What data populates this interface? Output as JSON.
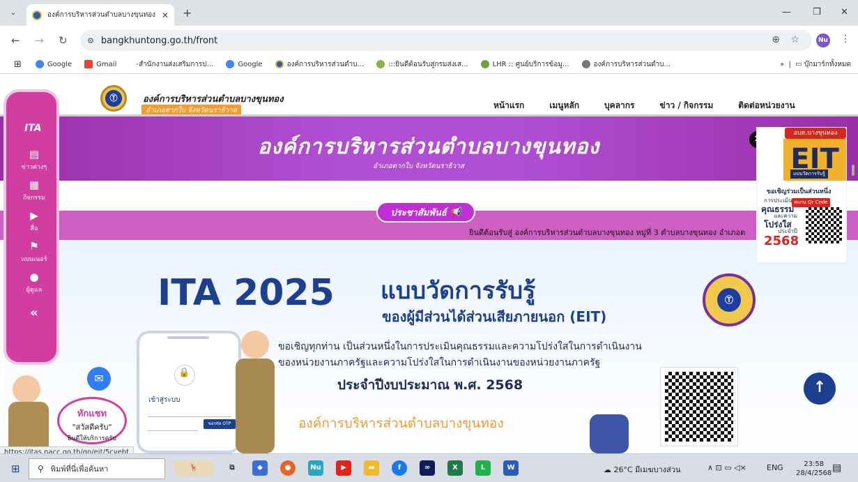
{
  "browser": {
    "tab_title": "องค์การบริหารส่วนตำบลบางขุนทอง",
    "url": "bangkhuntong.go.th/front",
    "profile": "Nu",
    "bookmarks": [
      "Google",
      "Gmail",
      "-สำนักงานส่งเสริมการป...",
      "Google",
      "องค์การบริหารส่วนตำบ...",
      ":::ยินดีต้อนรับสู่กรมส่งเส...",
      "LHR :: ศูนย์บริการข้อมู...",
      "องค์การบริหารส่วนตำบ..."
    ],
    "bookmarks_all": "บุ๊กมาร์กทั้งหมด",
    "status_url": "https://itas.nacc.go.th/go/eit/5cvebt"
  },
  "site": {
    "org_name": "องค์การบริหารส่วนตำบลบางขุนทอง",
    "org_sub": "อำเภอตากใบ จังหวัดนราธิวาส",
    "menu": [
      "หน้าแรก",
      "เมนูหลัก",
      "บุคลากร",
      "ข่าว / กิจกรรม",
      "ติดต่อหน่วยงาน"
    ],
    "banner_title": "องค์การบริหารส่วนตำบลบางขุนทอง",
    "banner_sub": "อำเภอตากใบ จังหวัดนราธิวาส",
    "pr_label": "ประชาสัมพันธ์",
    "marquee": "ยินดีต้อนรับสู่ องค์การบริหารส่วนตำบลบางขุนทอง หมู่ที่ 3 ตำบลบางขุนทอง อำเภอต"
  },
  "sidenav": {
    "logo": "ITA",
    "items": [
      {
        "icon": "news-icon",
        "glyph": "▤",
        "label": "ข่าวต่างๆ"
      },
      {
        "icon": "calendar-icon",
        "glyph": "▦",
        "label": "กิจกรรม"
      },
      {
        "icon": "play-icon",
        "glyph": "▶",
        "label": "สื่อ"
      },
      {
        "icon": "flag-icon",
        "glyph": "⚑",
        "label": "แบนเนอร์"
      },
      {
        "icon": "user-icon",
        "glyph": "●",
        "label": "ผู้ดูแล"
      }
    ],
    "collapse": "«"
  },
  "ita": {
    "year": "ITA 2025",
    "title1": "แบบวัดการรับรู้",
    "title2": "ของผู้มีส่วนได้ส่วนเสียภายนอก (EIT)",
    "p1": "ขอเชิญทุกท่าน เป็นส่วนหนึ่งในการประเมินคุณธรรมและความโปร่งใสในการดำเนินงาน",
    "p2": "ของหน่วยงานภาครัฐและความโปร่งใสในการดำเนินงานของหน่วยงานภาครัฐ",
    "budget": "ประจำปีงบประมาณ พ.ศ. 2568",
    "org": "องค์การบริหารส่วนตำบลบางขุนทอง",
    "phone_login": "เข้าสู่ระบบ",
    "phone_btn": "ขอรหัส OTP"
  },
  "chat": {
    "line1": "ทักแชท",
    "line2": "\"สวัสดีครับ\"",
    "line3": "ยินดีให้บริการครับ"
  },
  "ad": {
    "badge": "อบต.บางขุนทอง",
    "eit": "EIT",
    "eit_sub": "แบบวัดการรับรู้",
    "invite": "ขอเชิญร่วมเป็นส่วนหนึ่ง",
    "t1": "การประเมิน",
    "t2": "คุณธรรม",
    "t3": "และความ",
    "t4": "โปร่งใส",
    "t5": "ประจำปี",
    "year": "2568",
    "scan": "สแกน Qr Code",
    "close": "×"
  },
  "taskbar": {
    "search_placeholder": "พิมพ์ที่นี่เพื่อค้นหา",
    "weather": "26°C มีเมฆบางส่วน",
    "lang": "ENG",
    "time": "23:58",
    "date": "28/4/2568"
  },
  "colors": {
    "accent_purple": "#b04fd4",
    "accent_pink": "#d23da0",
    "navy": "#1d3f8f",
    "orange": "#f29b2f"
  }
}
